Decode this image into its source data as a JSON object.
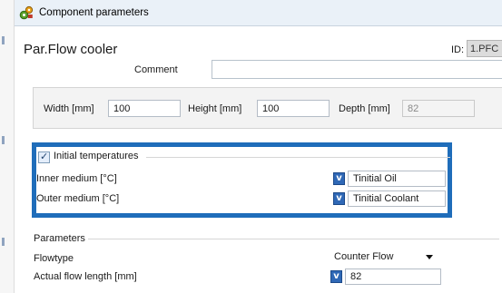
{
  "window": {
    "title": "Component parameters"
  },
  "component": {
    "name": "Par.Flow cooler",
    "id_label": "ID:",
    "id_value": "1.PFC",
    "comment_label": "Comment",
    "comment_value": ""
  },
  "dimensions": {
    "width_label": "Width [mm]",
    "width_value": "100",
    "height_label": "Height [mm]",
    "height_value": "100",
    "depth_label": "Depth [mm]",
    "depth_value": "82"
  },
  "initial_temperatures": {
    "checkbox_label": "Initial temperatures",
    "checked": true,
    "inner_label": "Inner medium [°C]",
    "inner_button": "v",
    "inner_value": "Tinitial Oil",
    "outer_label": "Outer medium [°C]",
    "outer_button": "v",
    "outer_value": "Tinitial Coolant"
  },
  "parameters": {
    "section_label": "Parameters",
    "flowtype_label": "Flowtype",
    "flowtype_value": "Counter Flow",
    "flow_length_label": "Actual flow length [mm]",
    "flow_length_button": "v",
    "flow_length_value": "82"
  },
  "colors": {
    "highlight_frame": "#1f6dba",
    "titlebar": "#eaf1f8",
    "v_button": "#2f68b6"
  }
}
